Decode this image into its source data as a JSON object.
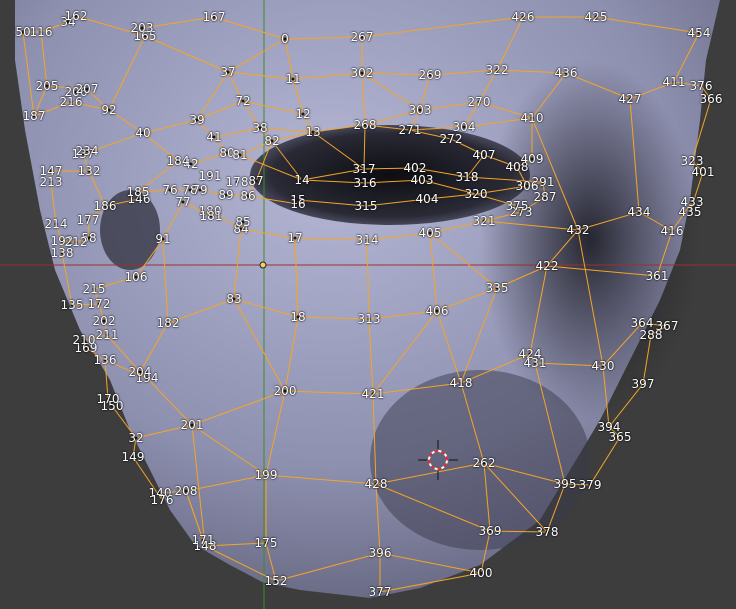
{
  "viewport": {
    "background": "#3d3d3d",
    "mesh_fill_light": "#9a9cc0",
    "mesh_fill_dark": "#15151c",
    "edge_color": "#f5a526",
    "axis_x_color": "#9b2f2f",
    "axis_y_color": "#3f8a2a",
    "vertex_labels": [
      "0",
      "11",
      "12",
      "13",
      "14",
      "15",
      "16",
      "17",
      "18",
      "32",
      "34",
      "37",
      "38",
      "39",
      "40",
      "41",
      "42",
      "50",
      "58",
      "72",
      "76",
      "77",
      "78",
      "79",
      "80",
      "81",
      "82",
      "83",
      "84",
      "85",
      "86",
      "87",
      "89",
      "91",
      "92",
      "106",
      "116",
      "132",
      "135",
      "136",
      "137",
      "138",
      "140",
      "146",
      "147",
      "148",
      "149",
      "150",
      "152",
      "162",
      "165",
      "167",
      "169",
      "170",
      "171",
      "172",
      "175",
      "176",
      "177",
      "178",
      "180",
      "181",
      "182",
      "184",
      "185",
      "186",
      "187",
      "191",
      "192",
      "194",
      "199",
      "200",
      "201",
      "202",
      "203",
      "204",
      "205",
      "206",
      "207",
      "208",
      "210",
      "211",
      "212",
      "213",
      "214",
      "215",
      "216",
      "234",
      "262",
      "267",
      "268",
      "269",
      "270",
      "271",
      "272",
      "273",
      "287",
      "288",
      "291",
      "302",
      "303",
      "304",
      "306",
      "313",
      "314",
      "315",
      "316",
      "317",
      "318",
      "320",
      "321",
      "322",
      "323",
      "335",
      "361",
      "364",
      "365",
      "366",
      "367",
      "369",
      "375",
      "376",
      "377",
      "378",
      "379",
      "394",
      "395",
      "396",
      "397",
      "400",
      "401",
      "402",
      "403",
      "404",
      "405",
      "406",
      "407",
      "408",
      "409",
      "410",
      "411",
      "416",
      "418",
      "421",
      "422",
      "424",
      "425",
      "426",
      "427",
      "428",
      "430",
      "431",
      "432",
      "433",
      "434",
      "435",
      "436",
      "454"
    ],
    "icons": [
      "3d-cursor-icon",
      "origin-point-icon"
    ]
  }
}
